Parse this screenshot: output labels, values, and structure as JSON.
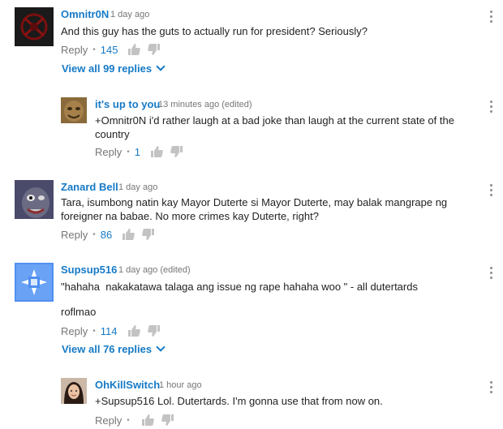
{
  "comments": [
    {
      "author": "Omnitr0N",
      "time": "1 day ago",
      "text": "And this guy has the guts to actually run for president? Seriously?",
      "reply_label": "Reply",
      "likes": "145",
      "view_replies": "View all 99 replies"
    },
    {
      "author": "it's up to you",
      "time": "13 minutes ago (edited)",
      "text": "+Omnitr0N i'd rather laugh at a bad joke than laugh at the current state of the country",
      "reply_label": "Reply",
      "likes": "1"
    },
    {
      "author": "Zanard Bell",
      "time": "1 day ago",
      "text": "Tara, isumbong natin kay Mayor Duterte si Mayor Duterte, may balak mangrape ng foreigner na babae. No more crimes kay Duterte, right?",
      "reply_label": "Reply",
      "likes": "86"
    },
    {
      "author": "Supsup516",
      "time": "1 day ago (edited)",
      "text": "\"hahaha  nakakatawa talaga ang issue ng rape hahaha woo \" - all dutertards",
      "text2": "roflmao",
      "reply_label": "Reply",
      "likes": "114",
      "view_replies": "View all 76 replies"
    },
    {
      "author": "OhKillSwitch",
      "time": "1 hour ago",
      "text": "+Supsup516 Lol. Dutertards. I'm gonna use that from now on.",
      "reply_label": "Reply",
      "likes": ""
    }
  ],
  "colors": {
    "link": "#167ac6",
    "meta": "#767676",
    "text": "#222222"
  },
  "icons": [
    "thumbs-up-icon",
    "thumbs-down-icon",
    "more-vert-icon",
    "chevron-down-icon"
  ]
}
